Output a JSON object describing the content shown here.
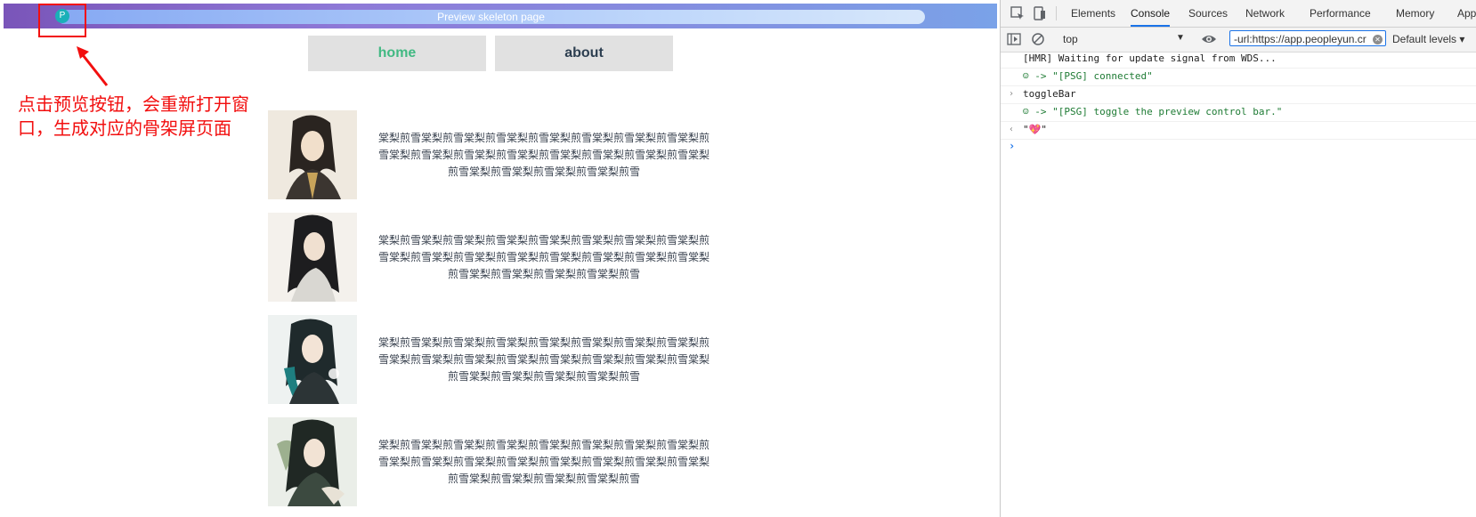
{
  "preview_bar": {
    "title": "Preview skeleton page",
    "button_label": "P"
  },
  "annotation": {
    "text": "点击预览按钮，会重新打开窗口，生成对应的骨架屏页面",
    "color": "#f20f0f"
  },
  "nav": {
    "home_label": "home",
    "about_label": "about",
    "active_color": "#42b983"
  },
  "cards": [
    {
      "text": "棠梨煎雪棠梨煎雪棠梨煎雪棠梨煎雪棠梨煎雪棠梨煎雪棠梨煎雪棠梨煎雪棠梨煎雪棠梨煎雪棠梨煎雪棠梨煎雪棠梨煎雪棠梨煎雪棠梨煎雪棠梨煎雪棠梨煎雪棠梨煎雪棠梨煎雪棠梨煎雪"
    },
    {
      "text": "棠梨煎雪棠梨煎雪棠梨煎雪棠梨煎雪棠梨煎雪棠梨煎雪棠梨煎雪棠梨煎雪棠梨煎雪棠梨煎雪棠梨煎雪棠梨煎雪棠梨煎雪棠梨煎雪棠梨煎雪棠梨煎雪棠梨煎雪棠梨煎雪棠梨煎雪棠梨煎雪"
    },
    {
      "text": "棠梨煎雪棠梨煎雪棠梨煎雪棠梨煎雪棠梨煎雪棠梨煎雪棠梨煎雪棠梨煎雪棠梨煎雪棠梨煎雪棠梨煎雪棠梨煎雪棠梨煎雪棠梨煎雪棠梨煎雪棠梨煎雪棠梨煎雪棠梨煎雪棠梨煎雪棠梨煎雪"
    },
    {
      "text": "棠梨煎雪棠梨煎雪棠梨煎雪棠梨煎雪棠梨煎雪棠梨煎雪棠梨煎雪棠梨煎雪棠梨煎雪棠梨煎雪棠梨煎雪棠梨煎雪棠梨煎雪棠梨煎雪棠梨煎雪棠梨煎雪棠梨煎雪棠梨煎雪棠梨煎雪棠梨煎雪"
    }
  ],
  "devtools": {
    "tabs": [
      "Elements",
      "Console",
      "Sources",
      "Network",
      "Performance",
      "Memory",
      "App"
    ],
    "active_tab": "Console",
    "context": "top",
    "filter_value": "-url:https://app.peopleyun.cr",
    "levels": "Default levels",
    "console": [
      {
        "gutter": "",
        "text": "[HMR] Waiting for update signal from WDS...",
        "style": "normal"
      },
      {
        "gutter": "",
        "text": "☺ -> \"[PSG] connected\"",
        "style": "green"
      },
      {
        "gutter": "›",
        "text": "toggleBar",
        "style": "normal"
      },
      {
        "gutter": "",
        "text": "☺ -> \"[PSG] toggle the preview control bar.\"",
        "style": "green"
      },
      {
        "gutter": "‹",
        "text": "\"💖\"",
        "style": "normal"
      }
    ],
    "prompt": "›"
  }
}
